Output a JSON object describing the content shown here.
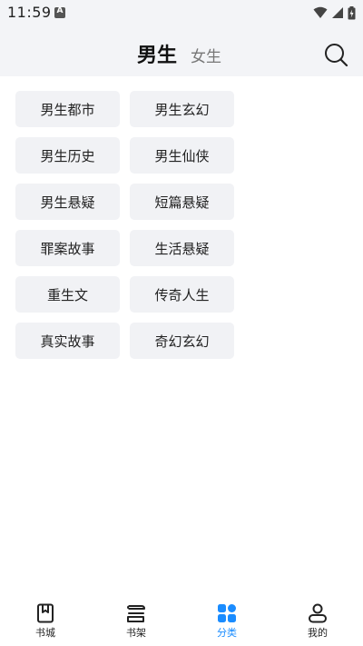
{
  "status_bar": {
    "time": "11:59",
    "a_icon_letter": "A",
    "icons": [
      "wifi-icon",
      "signal-icon",
      "battery-charging-icon"
    ]
  },
  "header": {
    "tab_male": "男生",
    "tab_female": "女生",
    "search_icon": "search-icon",
    "active_tab": "男生"
  },
  "categories": [
    "男生都市",
    "男生玄幻",
    "男生历史",
    "男生仙侠",
    "男生悬疑",
    "短篇悬疑",
    "罪案故事",
    "生活悬疑",
    "重生文",
    "传奇人生",
    "真实故事",
    "奇幻玄幻"
  ],
  "bottom_nav": {
    "items": [
      {
        "label": "书城",
        "icon": "bookstore-icon"
      },
      {
        "label": "书架",
        "icon": "bookshelf-icon"
      },
      {
        "label": "分类",
        "icon": "category-grid-icon"
      },
      {
        "label": "我的",
        "icon": "profile-icon"
      }
    ],
    "active": "分类"
  },
  "colors": {
    "accent": "#1a8cff",
    "header_bg": "#f3f4f7",
    "chip_bg": "#f1f2f5"
  }
}
